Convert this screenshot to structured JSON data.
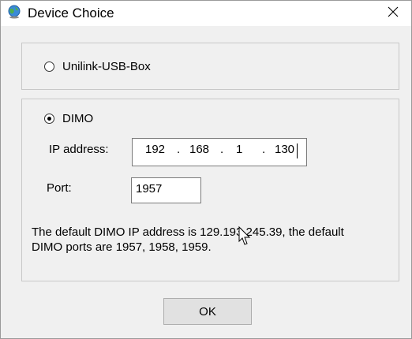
{
  "window": {
    "title": "Device Choice",
    "app_icon": "globe-app-icon",
    "close_icon": "close-icon"
  },
  "usb_option": {
    "label": "Unilink-USB-Box",
    "selected": false
  },
  "dimo_option": {
    "label": "DIMO",
    "selected": true
  },
  "ip_address": {
    "label": "IP address:",
    "octet1": "192",
    "octet2": "168",
    "octet3": "1",
    "octet4": "130",
    "separator": "."
  },
  "port": {
    "label": "Port:",
    "value": "1957"
  },
  "info": {
    "line1": "The default DIMO IP address is 129.193.245.39, the default",
    "line2": "DIMO ports are 1957, 1958, 1959."
  },
  "ok_button": {
    "label": "OK"
  }
}
